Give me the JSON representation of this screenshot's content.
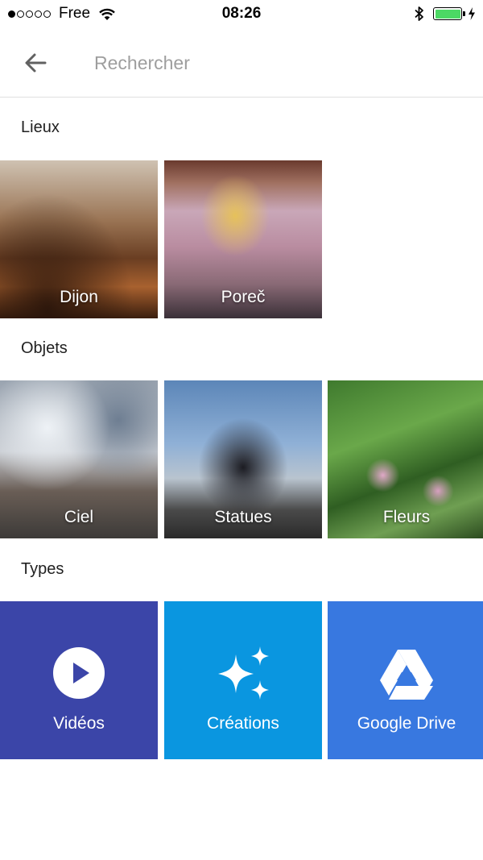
{
  "status_bar": {
    "carrier": "Free",
    "time": "08:26",
    "battery_color": "#4cd964"
  },
  "search": {
    "placeholder": "Rechercher",
    "value": ""
  },
  "sections": {
    "places": {
      "title": "Lieux",
      "items": [
        {
          "label": "Dijon"
        },
        {
          "label": "Poreč"
        }
      ]
    },
    "things": {
      "title": "Objets",
      "items": [
        {
          "label": "Ciel"
        },
        {
          "label": "Statues"
        },
        {
          "label": "Fleurs"
        }
      ]
    },
    "types": {
      "title": "Types",
      "items": [
        {
          "label": "Vidéos",
          "icon": "play-circle-icon",
          "color": "#3b45a8"
        },
        {
          "label": "Créations",
          "icon": "sparkles-icon",
          "color": "#0a96e0"
        },
        {
          "label": "Google Drive",
          "icon": "google-drive-icon",
          "color": "#3878e0"
        }
      ]
    }
  }
}
